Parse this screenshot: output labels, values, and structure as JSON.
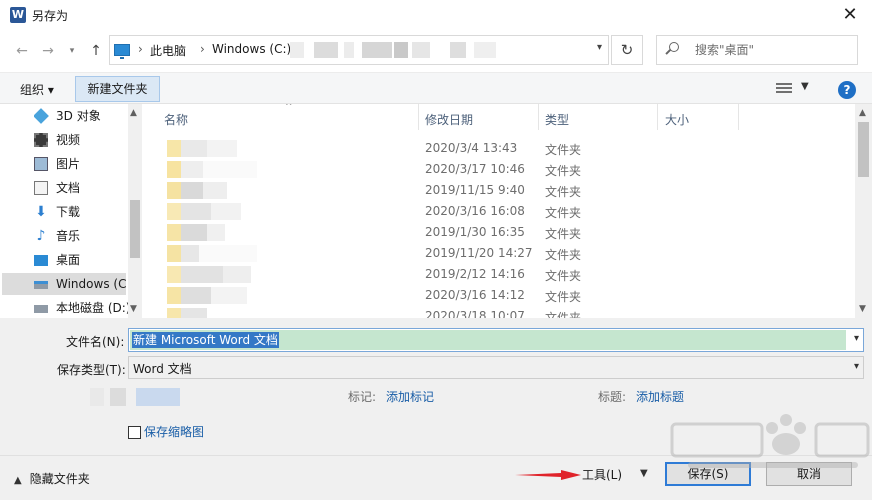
{
  "window": {
    "title": "另存为",
    "app_icon": "word-icon"
  },
  "address": {
    "crumbs": [
      "此电脑",
      "Windows (C:)"
    ]
  },
  "search": {
    "placeholder": "搜索\"桌面\""
  },
  "toolbar": {
    "organize_label": "组织 ▾",
    "new_folder_label": "新建文件夹"
  },
  "nav": {
    "items": [
      {
        "label": "3D 对象",
        "icon": "3d-objects-icon"
      },
      {
        "label": "视频",
        "icon": "video-icon"
      },
      {
        "label": "图片",
        "icon": "pictures-icon"
      },
      {
        "label": "文档",
        "icon": "documents-icon"
      },
      {
        "label": "下载",
        "icon": "downloads-icon"
      },
      {
        "label": "音乐",
        "icon": "music-icon"
      },
      {
        "label": "桌面",
        "icon": "desktop-icon"
      },
      {
        "label": "Windows (C:)",
        "icon": "drive-c-icon",
        "selected": true
      },
      {
        "label": "本地磁盘 (D:)",
        "icon": "drive-d-icon"
      }
    ]
  },
  "list": {
    "columns": {
      "name": "名称",
      "date": "修改日期",
      "type": "类型",
      "size": "大小"
    },
    "rows": [
      {
        "date": "2020/3/4 13:43",
        "type": "文件夹"
      },
      {
        "date": "2020/3/17 10:46",
        "type": "文件夹"
      },
      {
        "date": "2019/11/15 9:40",
        "type": "文件夹"
      },
      {
        "date": "2020/3/16 16:08",
        "type": "文件夹"
      },
      {
        "date": "2019/1/30 16:35",
        "type": "文件夹"
      },
      {
        "date": "2019/11/20 14:27",
        "type": "文件夹"
      },
      {
        "date": "2019/2/12 14:16",
        "type": "文件夹"
      },
      {
        "date": "2020/3/16 14:12",
        "type": "文件夹"
      },
      {
        "date": "2020/3/18 10:07",
        "type": "文件夹"
      }
    ]
  },
  "form": {
    "filename_label": "文件名(N):",
    "filename_value": "新建 Microsoft Word 文档",
    "filetype_label": "保存类型(T):",
    "filetype_value": "Word 文档",
    "tags_label": "标记:",
    "tags_link": "添加标记",
    "title_label": "标题:",
    "title_link": "添加标题",
    "thumbnail_label": "保存缩略图"
  },
  "footer": {
    "hide_folders": "隐藏文件夹",
    "tools_label": "工具(L)",
    "save_label": "保存(S)",
    "cancel_label": "取消"
  },
  "colors": {
    "accent": "#2e7bd6",
    "selection": "#3478c6",
    "filename_bg": "#c5e6cf",
    "link": "#1a5ea7",
    "arrow": "#e0242b"
  }
}
